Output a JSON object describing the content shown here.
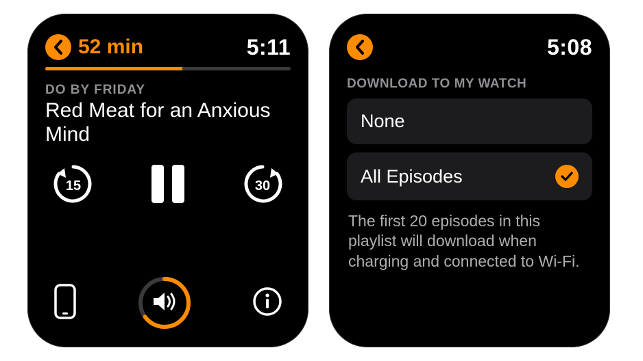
{
  "accent": "#ff8c00",
  "screen1": {
    "clock": "5:11",
    "remaining": "52 min",
    "progress_pct": 56,
    "podcast": "DO BY FRIDAY",
    "episode": "Red Meat for an Anxious Mind",
    "controls": {
      "skip_back_seconds": "15",
      "skip_forward_seconds": "30"
    },
    "volume_pct": 65
  },
  "screen2": {
    "clock": "5:08",
    "section_title": "DOWNLOAD TO MY WATCH",
    "options": {
      "none": "None",
      "all": "All Episodes"
    },
    "selected": "all",
    "footer": "The first 20 episodes in this playlist will download when charging and connected to Wi-Fi."
  }
}
